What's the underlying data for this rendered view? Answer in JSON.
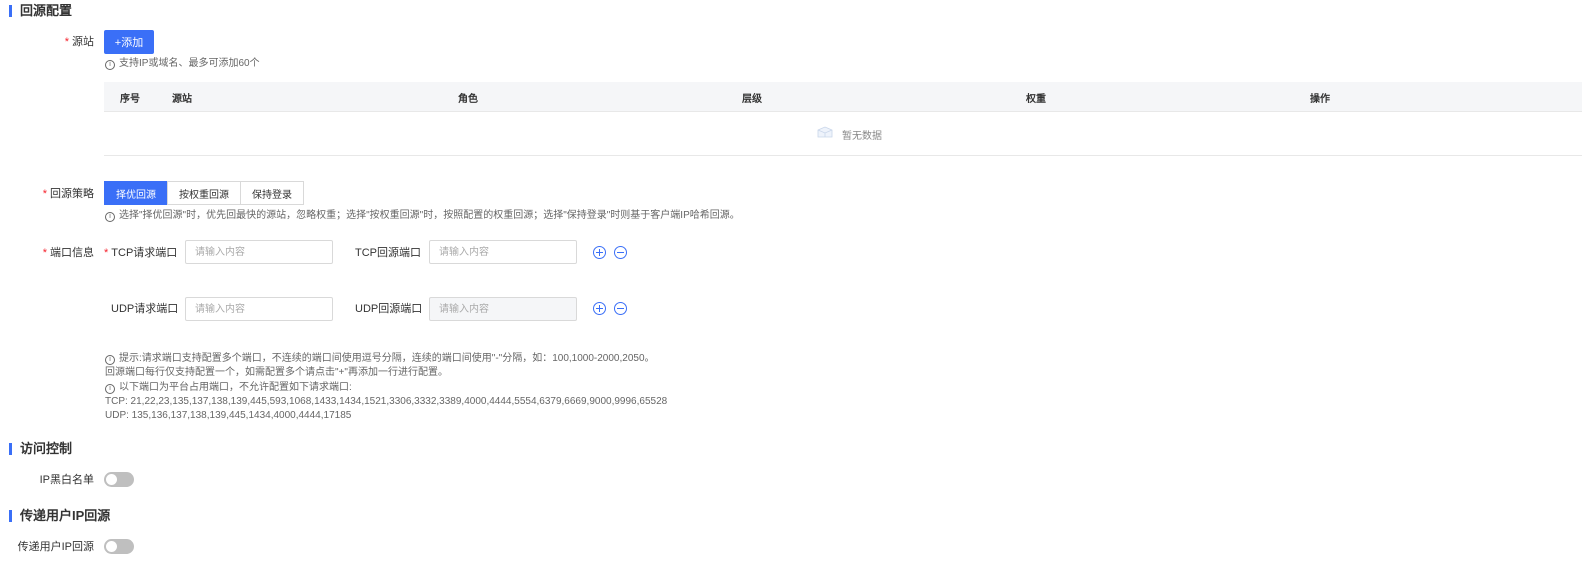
{
  "sections": {
    "origin_config": "回源配置",
    "access_control": "访问控制",
    "pass_user_ip": "传递用户IP回源"
  },
  "origin": {
    "label": "源站",
    "add_button": "+添加",
    "hint": "支持IP或域名、最多可添加60个",
    "table_headers": [
      "序号",
      "源站",
      "角色",
      "层级",
      "权重",
      "操作"
    ],
    "empty_text": "暂无数据"
  },
  "strategy": {
    "label": "回源策略",
    "options": [
      "择优回源",
      "按权重回源",
      "保持登录"
    ],
    "selected": "择优回源",
    "hint": "选择\"择优回源\"时，优先回最快的源站，忽略权重；选择\"按权重回源\"时，按照配置的权重回源；选择\"保持登录\"时则基于客户端IP哈希回源。"
  },
  "ports": {
    "label": "端口信息",
    "tcp_request_label": "TCP请求端口",
    "tcp_origin_label": "TCP回源端口",
    "udp_request_label": "UDP请求端口",
    "udp_origin_label": "UDP回源端口",
    "placeholder": "请输入内容",
    "tips": [
      "提示:请求端口支持配置多个端口，不连续的端口间使用逗号分隔，连续的端口间使用\"-\"分隔，如：100,1000-2000,2050。",
      "回源端口每行仅支持配置一个，如需配置多个请点击\"+\"再添加一行进行配置。",
      "以下端口为平台占用端口，不允许配置如下请求端口:",
      "TCP: 21,22,23,135,137,138,139,445,593,1068,1433,1434,1521,3306,3332,3389,4000,4444,5554,6379,6669,9000,9996,65528",
      "UDP: 135,136,137,138,139,445,1434,4000,4444,17185"
    ]
  },
  "access": {
    "ip_blacklist_label": "IP黑白名单",
    "ip_blacklist_enabled": false
  },
  "pass_ip": {
    "label": "传递用户IP回源",
    "enabled": false
  },
  "colors": {
    "accent": "#3a6ff7",
    "required": "#f5222d"
  }
}
